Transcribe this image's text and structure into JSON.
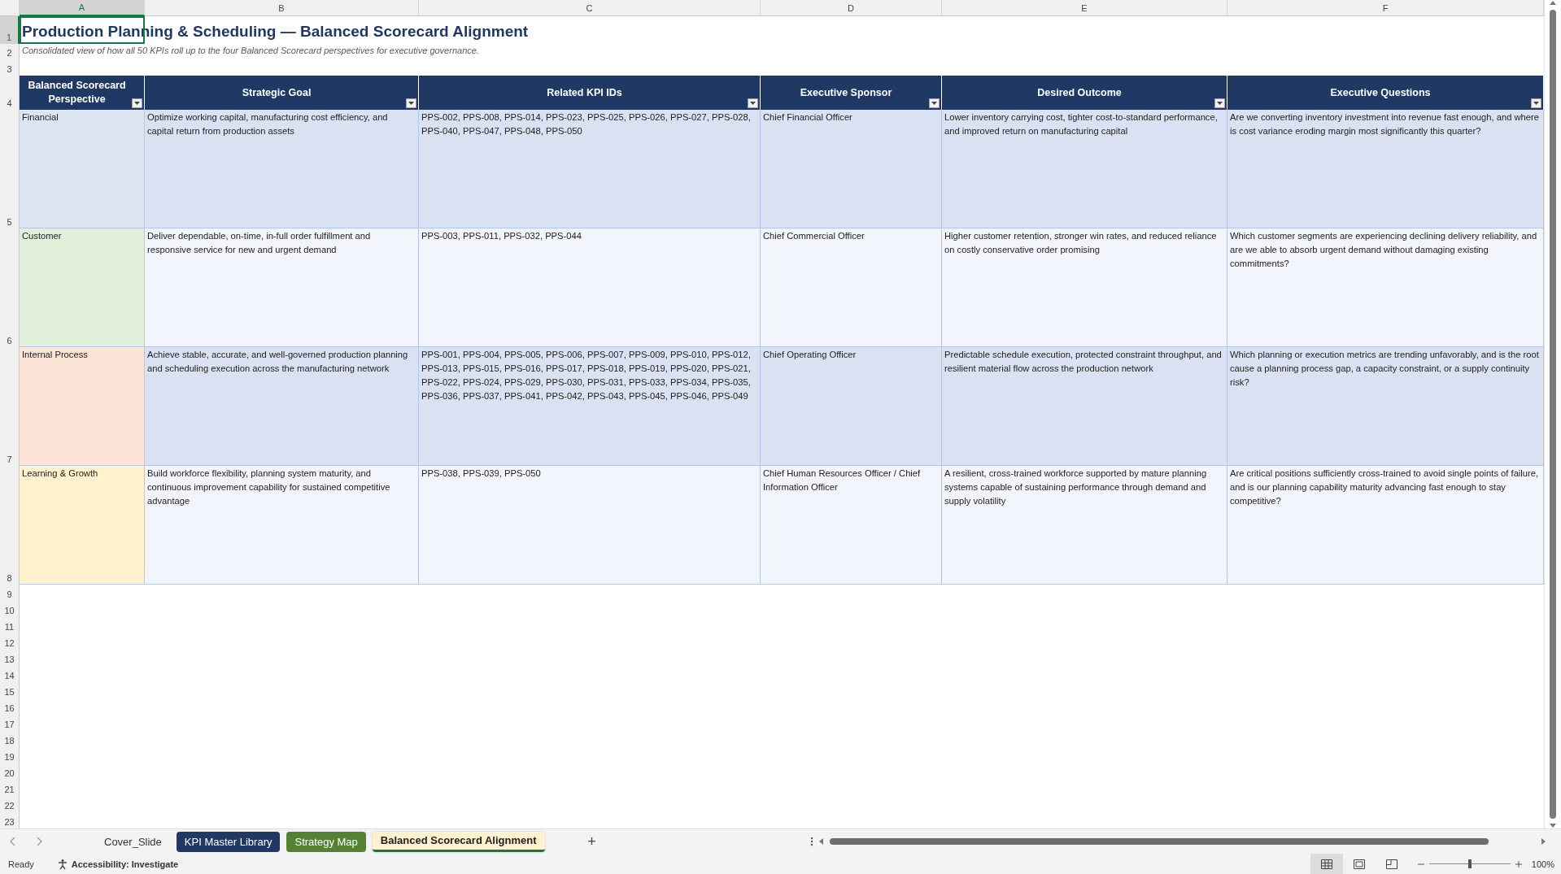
{
  "column_headers": [
    {
      "label": "A",
      "selected": true
    },
    {
      "label": "B",
      "selected": false
    },
    {
      "label": "C",
      "selected": false
    },
    {
      "label": "D",
      "selected": false
    },
    {
      "label": "E",
      "selected": false
    },
    {
      "label": "F",
      "selected": false
    }
  ],
  "row_numbers": [
    {
      "label": "1",
      "selected": true
    },
    {
      "label": "2",
      "selected": false
    },
    {
      "label": "3",
      "selected": false
    },
    {
      "label": "4",
      "selected": false
    },
    {
      "label": "5",
      "selected": false
    },
    {
      "label": "6",
      "selected": false
    },
    {
      "label": "7",
      "selected": false
    },
    {
      "label": "8",
      "selected": false
    },
    {
      "label": "9",
      "selected": false
    },
    {
      "label": "10",
      "selected": false
    },
    {
      "label": "11",
      "selected": false
    },
    {
      "label": "12",
      "selected": false
    },
    {
      "label": "13",
      "selected": false
    },
    {
      "label": "14",
      "selected": false
    },
    {
      "label": "15",
      "selected": false
    },
    {
      "label": "16",
      "selected": false
    },
    {
      "label": "17",
      "selected": false
    },
    {
      "label": "18",
      "selected": false
    },
    {
      "label": "19",
      "selected": false
    },
    {
      "label": "20",
      "selected": false
    },
    {
      "label": "21",
      "selected": false
    },
    {
      "label": "22",
      "selected": false
    },
    {
      "label": "23",
      "selected": false
    }
  ],
  "title": "Production Planning & Scheduling — Balanced Scorecard Alignment",
  "subtitle": "Consolidated view of how all 50 KPIs roll up to the four Balanced Scorecard perspectives for executive governance.",
  "table": {
    "columns": [
      {
        "label": "Balanced Scorecard Perspective",
        "filter": true
      },
      {
        "label": "Strategic Goal",
        "filter": true
      },
      {
        "label": "Related KPI IDs",
        "filter": true
      },
      {
        "label": "Executive Sponsor",
        "filter": true
      },
      {
        "label": "Desired Outcome",
        "filter": true
      },
      {
        "label": "Executive Questions",
        "filter": true
      }
    ],
    "rows": [
      {
        "perspective": "Financial",
        "color": "#dce6f2",
        "goal": "Optimize working capital, manufacturing cost efficiency, and capital return from production assets",
        "kpi_ids": "PPS-002, PPS-008, PPS-014, PPS-023, PPS-025, PPS-026, PPS-027, PPS-028, PPS-040, PPS-047, PPS-048, PPS-050",
        "sponsor": "Chief Financial Officer",
        "outcome": "Lower inventory carrying cost, tighter cost-to-standard performance, and improved return on manufacturing capital",
        "questions": "Are we converting inventory investment into revenue fast enough, and where is cost variance eroding margin most significantly this quarter?"
      },
      {
        "perspective": "Customer",
        "color": "#e2efda",
        "goal": "Deliver dependable, on-time, in-full order fulfillment and responsive service for new and urgent demand",
        "kpi_ids": "PPS-003, PPS-011, PPS-032, PPS-044",
        "sponsor": "Chief Commercial Officer",
        "outcome": "Higher customer retention, stronger win rates, and reduced reliance on costly conservative order promising",
        "questions": "Which customer segments are experiencing declining delivery reliability, and are we able to absorb urgent demand without damaging existing commitments?"
      },
      {
        "perspective": "Internal Process",
        "color": "#fce4d6",
        "goal": "Achieve stable, accurate, and well-governed production planning and scheduling execution across the manufacturing network",
        "kpi_ids": "PPS-001, PPS-004, PPS-005, PPS-006, PPS-007, PPS-009, PPS-010, PPS-012, PPS-013, PPS-015, PPS-016, PPS-017, PPS-018, PPS-019, PPS-020, PPS-021, PPS-022, PPS-024, PPS-029, PPS-030, PPS-031, PPS-033, PPS-034, PPS-035, PPS-036, PPS-037, PPS-041, PPS-042, PPS-043, PPS-045, PPS-046, PPS-049",
        "sponsor": "Chief Operating Officer",
        "outcome": "Predictable schedule execution, protected constraint throughput, and resilient material flow across the production network",
        "questions": "Which planning or execution metrics are trending unfavorably, and is the root cause a planning process gap, a capacity constraint, or a supply continuity risk?"
      },
      {
        "perspective": "Learning & Growth",
        "color": "#fff2cc",
        "goal": "Build workforce flexibility, planning system maturity, and continuous improvement capability for sustained competitive advantage",
        "kpi_ids": "PPS-038, PPS-039, PPS-050",
        "sponsor": "Chief Human Resources Officer / Chief Information Officer",
        "outcome": "A resilient, cross-trained workforce supported by mature planning systems capable of sustaining performance through demand and supply volatility",
        "questions": "Are critical positions sufficiently cross-trained to avoid single points of failure, and is our planning capability maturity advancing fast enough to stay competitive?"
      }
    ]
  },
  "sheet_tabs": [
    {
      "label": "Cover_Slide",
      "selected": false
    },
    {
      "label": "KPI Master Library",
      "color": "#1f3864",
      "selected": false
    },
    {
      "label": "Strategy Map",
      "color": "#548235",
      "selected": false
    },
    {
      "label": "Balanced Scorecard Alignment",
      "color": "#fdf1cf",
      "selected": true
    }
  ],
  "add_sheet": "+",
  "status": {
    "ready": "Ready",
    "accessibility": "Accessibility: Investigate",
    "zoom": {
      "level": 0.5,
      "reading": "100%"
    }
  }
}
